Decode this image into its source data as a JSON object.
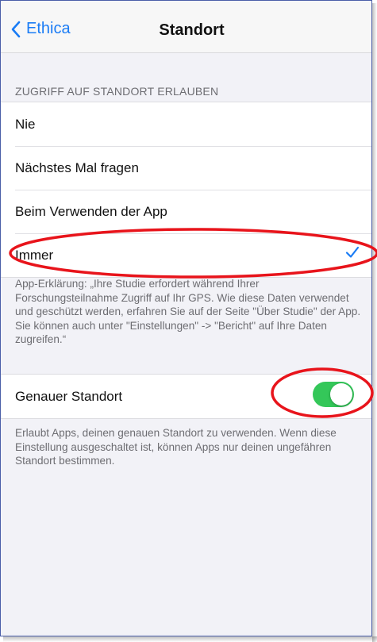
{
  "nav": {
    "back_label": "Ethica",
    "title": "Standort"
  },
  "location_access": {
    "header": "ZUGRIFF AUF STANDORT ERLAUBEN",
    "options": [
      {
        "label": "Nie",
        "selected": false
      },
      {
        "label": "Nächstes Mal fragen",
        "selected": false
      },
      {
        "label": "Beim Verwenden der App",
        "selected": false
      },
      {
        "label": "Immer",
        "selected": true
      }
    ],
    "explanation": "App-Erklärung: „Ihre Studie erfordert während Ihrer Forschungsteilnahme Zugriff auf Ihr GPS. Wie diese Daten verwendet und geschützt werden, erfahren Sie auf der Seite \"Über Studie\" der App. Sie können auch unter \"Einstellungen\" -> \"Bericht\" auf Ihre Daten zugreifen.“"
  },
  "precise_location": {
    "label": "Genauer Standort",
    "enabled": true,
    "description": "Erlaubt Apps, deinen genauen Standort zu verwenden. Wenn diese Einstellung ausgeschaltet ist, können Apps nur deinen ungefähren Standort bestimmen."
  },
  "colors": {
    "accent": "#1a7cf5",
    "toggle_on": "#34c759",
    "annotation": "#e8141b",
    "background": "#f2f2f7"
  },
  "icons": {
    "back": "chevron-left-icon",
    "selected": "checkmark-icon"
  }
}
